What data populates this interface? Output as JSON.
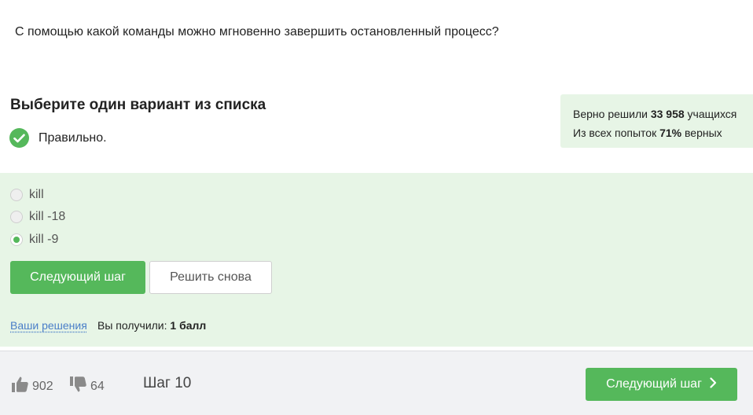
{
  "question": {
    "text": "С помощью какой команды можно мгновенно завершить остановленный процесс?"
  },
  "quiz": {
    "choose_title": "Выберите один вариант из списка",
    "result_text": "Правильно.",
    "options": [
      {
        "label": "kill",
        "selected": false
      },
      {
        "label": "kill -18",
        "selected": false
      },
      {
        "label": "kill -9",
        "selected": true
      }
    ],
    "next_step_label": "Следующий шаг",
    "retry_label": "Решить снова",
    "solutions_link": "Ваши решения",
    "score_prefix": "Вы получили:",
    "score_value": "1 балл"
  },
  "stats": {
    "solved_prefix": "Верно решили",
    "solved_count": "33 958",
    "solved_suffix": "учащихся",
    "attempts_prefix": "Из всех попыток",
    "attempts_percent": "71%",
    "attempts_suffix": "верных"
  },
  "footer": {
    "likes": "902",
    "dislikes": "64",
    "step": "Шаг 10",
    "next_button": "Следующий шаг"
  },
  "colors": {
    "accent_green": "#55b85b",
    "answer_background": "#e7f5e6",
    "link_blue": "#4a7ec8",
    "footer_background": "#f1f2f4"
  },
  "icons": {
    "result": "check-circle-icon",
    "like": "thumbs-up-icon",
    "dislike": "thumbs-down-icon",
    "next": "chevron-right-icon"
  }
}
